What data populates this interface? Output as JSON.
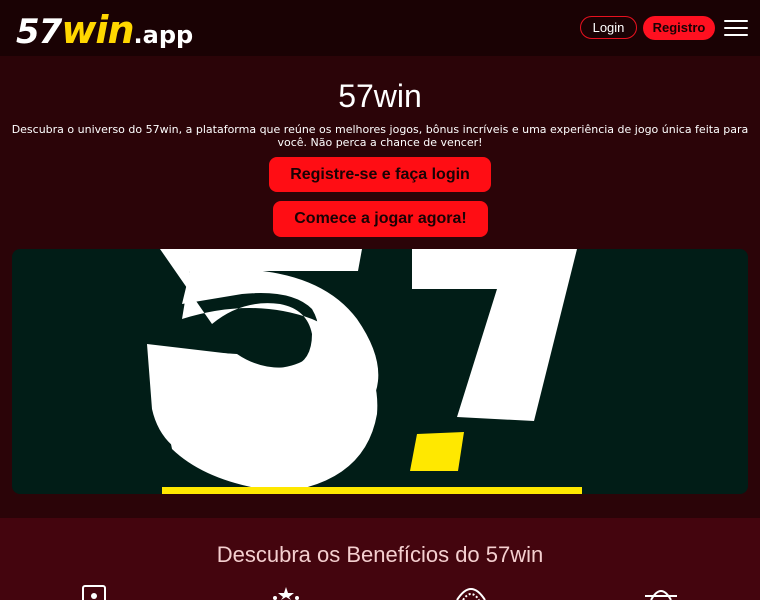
{
  "header": {
    "logo": {
      "num": "57",
      "win": "win",
      "tld": ".app"
    },
    "login_label": "Login",
    "register_label": "Registro",
    "menu_icon": "hamburger-menu-icon"
  },
  "hero": {
    "title": "57win",
    "description": "Descubra o universo do 57win, a plataforma que reúne os melhores jogos, bônus incríveis e uma experiência de jogo única feita para você. Não perca a chance de vencer!",
    "cta_primary": "Registre-se e faça login",
    "cta_secondary": "Comece a jogar agora!"
  },
  "benefits": {
    "title": "Descubra os Benefícios do 57win",
    "icons": [
      "document-icon",
      "stars-icon",
      "chip-icon",
      "bag-icon"
    ]
  },
  "colors": {
    "accent": "#ff1020",
    "brand_yellow": "#ffd700",
    "header_bg": "#1a0204",
    "page_bg": "#2b0408",
    "benefits_bg": "#44050e",
    "banner_bg": "#011d17"
  }
}
